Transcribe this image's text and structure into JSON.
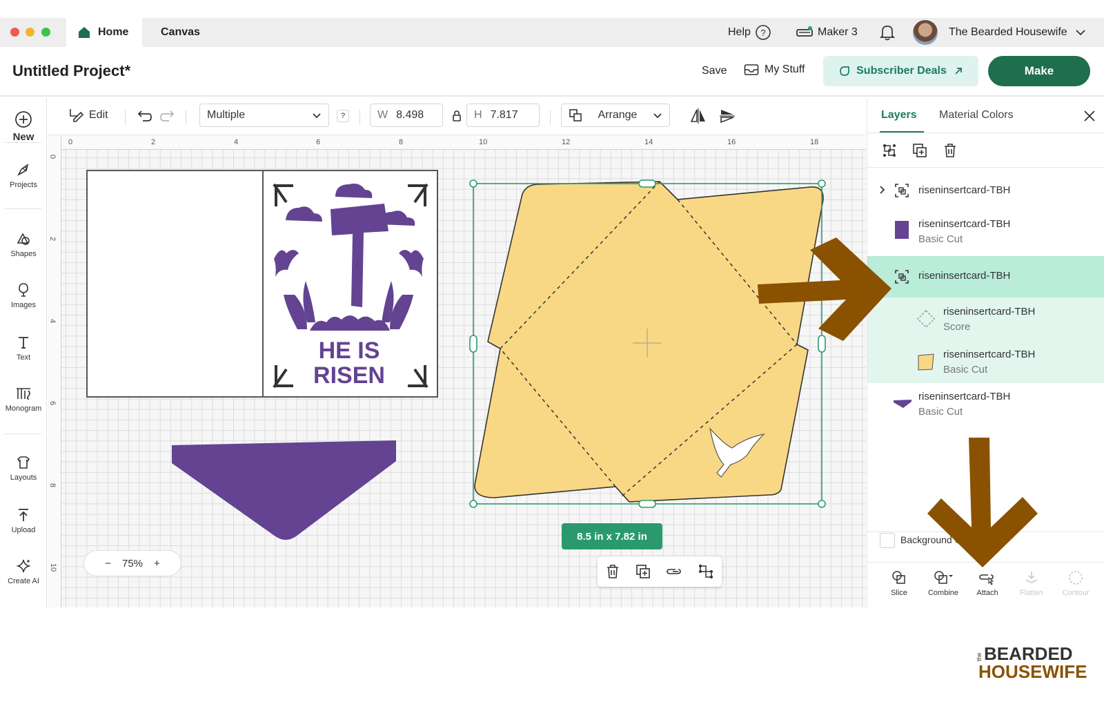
{
  "window": {
    "tabs": [
      {
        "label": "Home"
      },
      {
        "label": "Canvas"
      }
    ],
    "help_label": "Help",
    "machine_label": "Maker 3",
    "user_name": "The Bearded Housewife"
  },
  "header": {
    "project_title": "Untitled Project*",
    "save_label": "Save",
    "my_stuff_label": "My Stuff",
    "deals_label": "Subscriber Deals",
    "make_label": "Make"
  },
  "sidebar": {
    "items": [
      {
        "label": "New",
        "icon": "plus-circle-icon"
      },
      {
        "label": "Projects",
        "icon": "projects-icon"
      },
      {
        "label": "Shapes",
        "icon": "shapes-icon"
      },
      {
        "label": "Images",
        "icon": "images-icon"
      },
      {
        "label": "Text",
        "icon": "text-icon"
      },
      {
        "label": "Monogram",
        "icon": "monogram-icon"
      },
      {
        "label": "Layouts",
        "icon": "layouts-icon"
      },
      {
        "label": "Upload",
        "icon": "upload-icon"
      },
      {
        "label": "Create AI",
        "icon": "sparkle-icon"
      }
    ]
  },
  "toolbar": {
    "edit_label": "Edit",
    "operation_value": "Multiple",
    "help_q": "?",
    "w_label": "W",
    "w_value": "8.498",
    "h_label": "H",
    "h_value": "7.817",
    "arrange_label": "Arrange"
  },
  "canvas": {
    "ruler_x": [
      "0",
      "2",
      "4",
      "6",
      "8",
      "10",
      "12",
      "14",
      "16",
      "18"
    ],
    "ruler_y": [
      "0",
      "2",
      "4",
      "6",
      "8",
      "10"
    ],
    "card_text_line1": "HE IS",
    "card_text_line2": "RISEN",
    "zoom_minus": "−",
    "zoom_value": "75%",
    "zoom_plus": "+",
    "selection_size": "8.5  in x 7.82  in"
  },
  "colors": {
    "purple": "#634392",
    "yellow": "#f8d885",
    "brand_green": "#1f6e4e",
    "selection_green": "#2a9a6e",
    "arrow_brown": "#8a5200"
  },
  "panel": {
    "tabs": [
      "Layers",
      "Material Colors"
    ],
    "layers": [
      {
        "name": "riseninsertcard-TBH",
        "type": ""
      },
      {
        "name": "riseninsertcard-TBH",
        "type": "Basic Cut"
      },
      {
        "name": "riseninsertcard-TBH",
        "type": ""
      },
      {
        "name": "riseninsertcard-TBH",
        "type": "Score"
      },
      {
        "name": "riseninsertcard-TBH",
        "type": "Basic Cut"
      },
      {
        "name": "riseninsertcard-TBH",
        "type": "Basic Cut"
      }
    ],
    "background_label": "Background C",
    "ops": [
      {
        "label": "Slice"
      },
      {
        "label": "Combine"
      },
      {
        "label": "Attach"
      },
      {
        "label": "Flatten"
      },
      {
        "label": "Contour"
      }
    ]
  },
  "watermark": {
    "small": "the",
    "line1": "BEARDED",
    "line2": "HOUSEWIFE"
  }
}
